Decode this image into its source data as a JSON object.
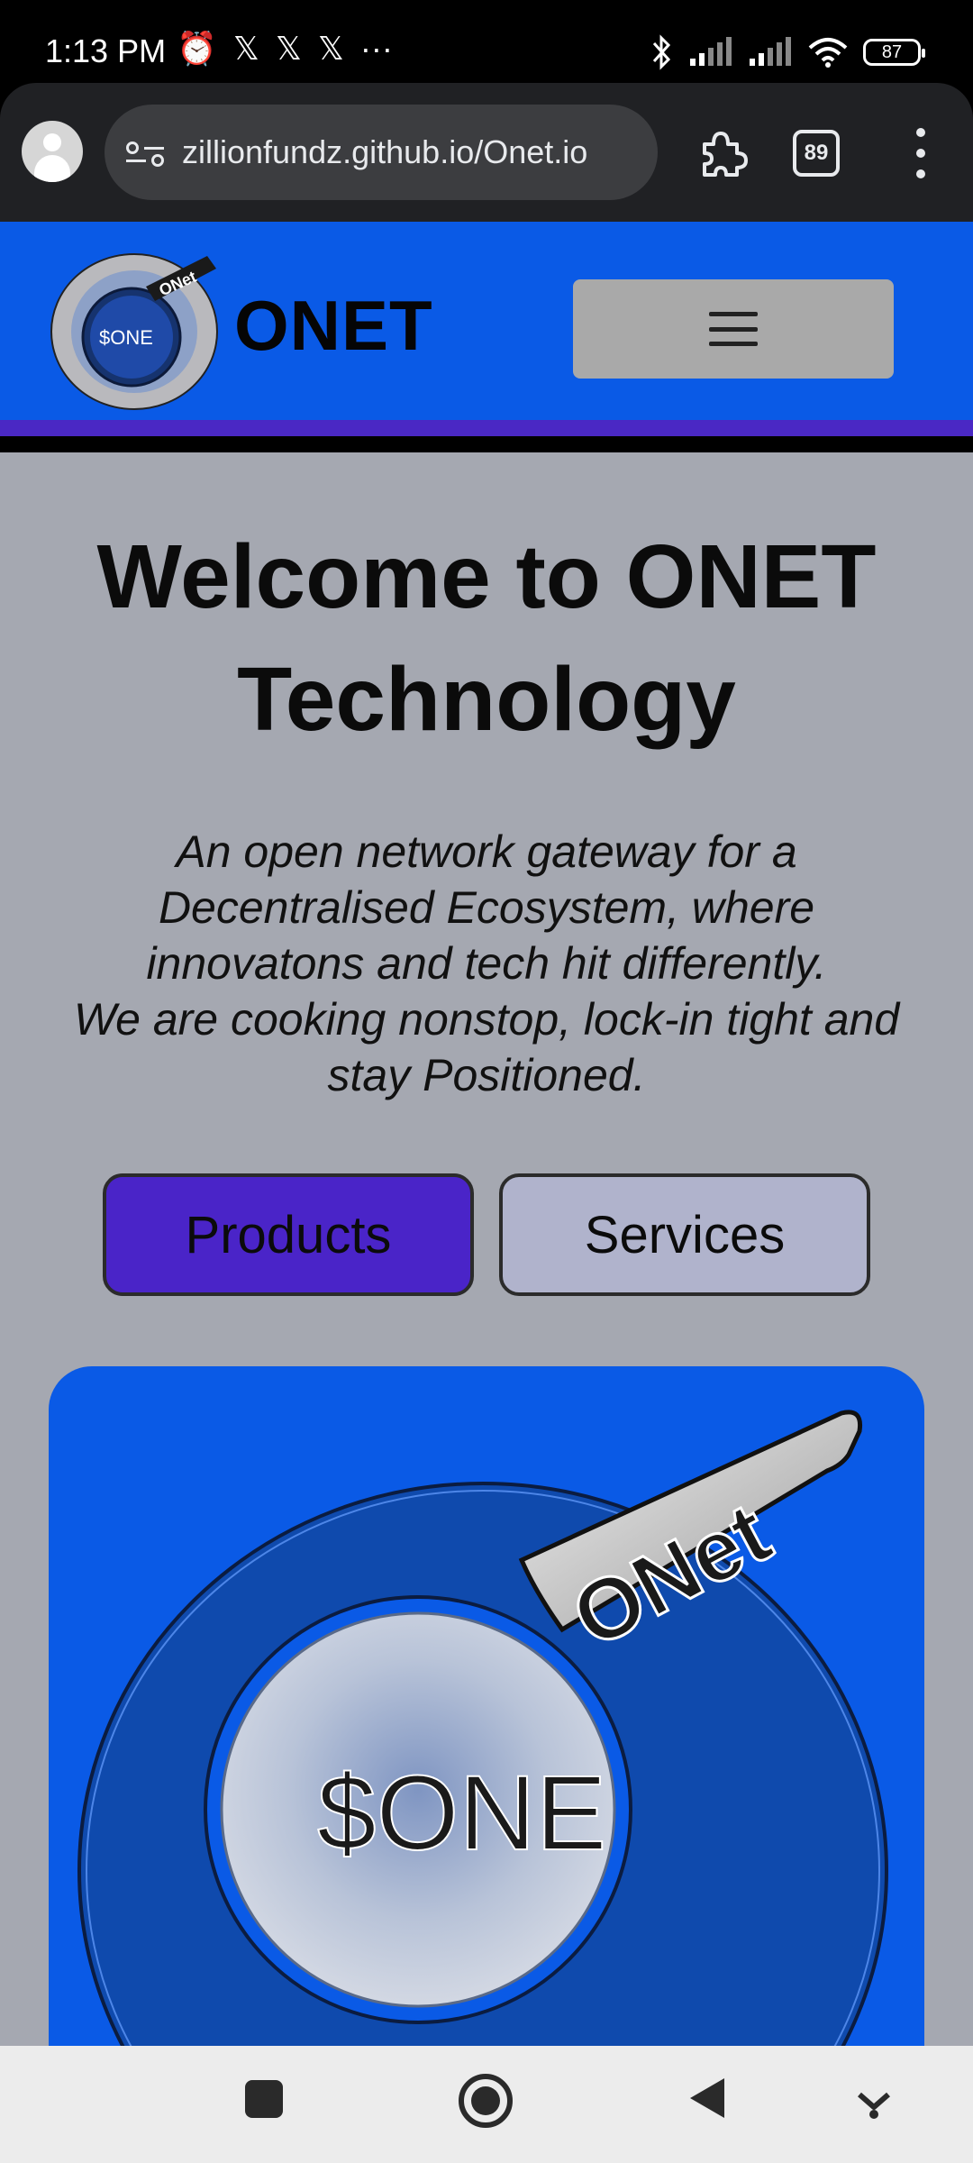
{
  "status_bar": {
    "time": "1:13 PM",
    "left_icons": [
      "alarm-icon",
      "x-logo-icon",
      "x-logo-icon",
      "x-logo-icon",
      "more-dots-icon"
    ],
    "battery": "87"
  },
  "browser": {
    "url": "zillionfundz.github.io/Onet.io",
    "tab_count": "89"
  },
  "header": {
    "brand": "ONET",
    "logo_text_ring": "ONet",
    "logo_text_center": "$ONE"
  },
  "hero": {
    "title_line1": "Welcome to ONET",
    "title_line2": "Technology",
    "tagline_line1": "An open network gateway for a",
    "tagline_line2": "Decentralised Ecosystem, where",
    "tagline_line3": "innovatons and tech hit differently.",
    "tagline_line4": "We are cooking nonstop, lock-in tight and",
    "tagline_line5": "stay Positioned."
  },
  "buttons": {
    "products": "Products",
    "services": "Services"
  },
  "hero_logo": {
    "ring_text": "ONet",
    "center_text": "$ONE"
  },
  "colors": {
    "header_blue": "#0a5ae6",
    "accent_purple": "#4a28c4",
    "page_gray": "#a5a8b1",
    "services_btn": "#b0b3cc"
  }
}
